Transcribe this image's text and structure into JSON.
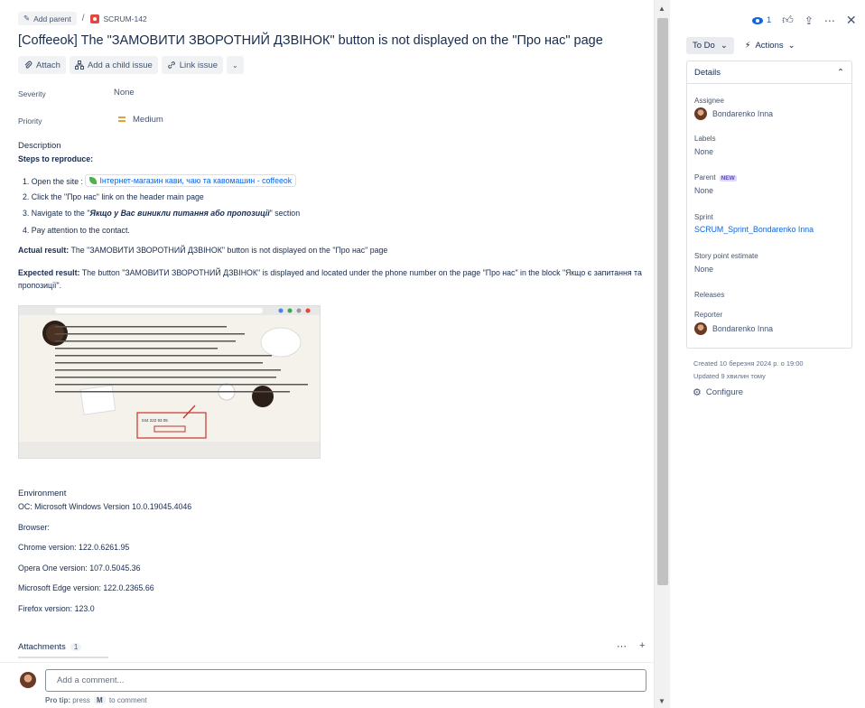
{
  "breadcrumb": {
    "add_parent": "Add parent",
    "separator": "/",
    "issue_key": "SCRUM-142"
  },
  "title": "[Coffeeok] The \"ЗАМОВИТИ ЗВОРОТНИЙ ДЗВІНОК\" button is not displayed on the \"Про нас\" page",
  "toolbar": {
    "attach": "Attach",
    "add_child": "Add a child issue",
    "link_issue": "Link issue"
  },
  "fields": {
    "severity_label": "Severity",
    "severity_value": "None",
    "priority_label": "Priority",
    "priority_value": "Medium"
  },
  "description": {
    "label": "Description",
    "steps_heading": "Steps to reproduce:",
    "step1_prefix": "1. Open the  site : ",
    "step1_link": "Інтернет-магазин кави, чаю та кавомашин - coffeeok",
    "step2": "2. Click the \"Про нас\" link on the header main page",
    "step3_prefix": "3. Navigate to the \"",
    "step3_bold": "Якщо у Вас виникли питання або пропозиції",
    "step3_suffix": "\" section",
    "step4": "4. Pay attention to the contact.",
    "actual_label": "Actual result:",
    "actual_text": " The \"ЗАМОВИТИ ЗВОРОТНИЙ ДЗВІНОК\" button is not displayed on the \"Про нас\" page",
    "expected_label": "Expected result:",
    "expected_text": "  The button \"ЗАМОВИТИ ЗВОРОТНИЙ ДЗВІНОК\" is displayed and located under the phone number on the page \"Про нас\" in the block \"Якщо є запитання та пропозиції\"."
  },
  "screenshot": {
    "phone": "044 222 93 05"
  },
  "environment": {
    "label": "Environment",
    "os": "ОС: Microsoft Windows Version 10.0.19045.4046",
    "browser": "Browser:",
    "chrome": "Chrome version: 122.0.6261.95",
    "opera": "Opera One version: 107.0.5045.36",
    "edge": "Microsoft Edge version: 122.0.2365.66",
    "firefox": "Firefox version: 123.0"
  },
  "attachments": {
    "label": "Attachments",
    "count": "1"
  },
  "comment": {
    "placeholder": "Add a comment...",
    "protip_prefix": "Pro tip:",
    "protip_press": "press",
    "protip_key": "M",
    "protip_suffix": "to comment"
  },
  "sidebar": {
    "watch_count": "1",
    "status": "To Do",
    "actions": "Actions",
    "details_title": "Details",
    "assignee_label": "Assignee",
    "assignee_value": "Bondarenko Inna",
    "labels_label": "Labels",
    "labels_value": "None",
    "parent_label": "Parent",
    "parent_badge": "NEW",
    "parent_value": "None",
    "sprint_label": "Sprint",
    "sprint_value": "SCRUM_Sprint_Bondarenko Inna",
    "story_label": "Story point estimate",
    "story_value": "None",
    "releases_label": "Releases",
    "reporter_label": "Reporter",
    "reporter_value": "Bondarenko Inna",
    "created": "Created 10 березня 2024 р. о 19:00",
    "updated": "Updated 9 хвилин тому",
    "configure": "Configure"
  },
  "colors": {
    "link": "#0c66e4",
    "bug": "#e2483d",
    "priority_medium": "#e2a03f"
  }
}
